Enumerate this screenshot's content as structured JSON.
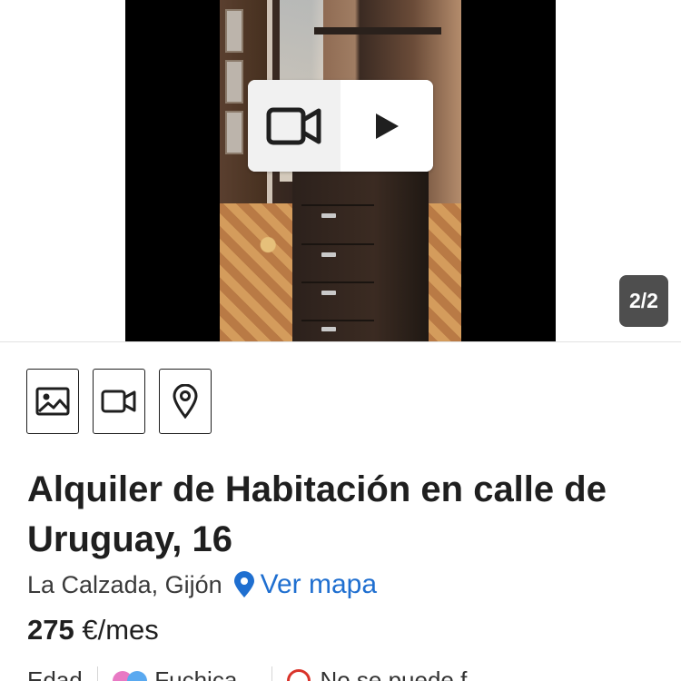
{
  "gallery": {
    "counter": "2/2"
  },
  "listing": {
    "title": "Alquiler de Habitación en calle de Uruguay, 16",
    "location": "La Calzada, Gijón",
    "map_link": "Ver mapa",
    "price_amount": "275",
    "price_unit": "€/mes"
  },
  "features": [
    {
      "label": "Edad"
    },
    {
      "label": "Fuchica..."
    },
    {
      "label": "No se puede f..."
    }
  ],
  "colors": {
    "link": "#1f6fd0",
    "text": "#1f1f1f",
    "counter_bg": "#4e4e4e"
  },
  "icons": {
    "action_photos": "image-icon",
    "action_video": "video-camera-icon",
    "action_map": "location-pin-icon",
    "video_overlay_left": "video-camera-icon",
    "video_overlay_right": "play-icon"
  }
}
